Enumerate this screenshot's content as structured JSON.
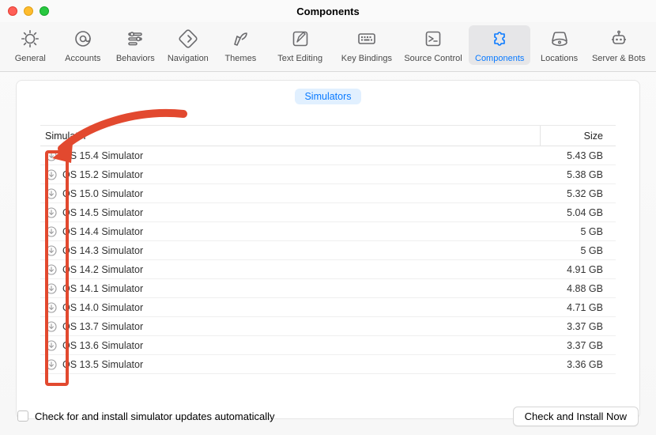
{
  "window": {
    "title": "Components"
  },
  "toolbar": {
    "items": [
      {
        "name": "general",
        "label": "General"
      },
      {
        "name": "accounts",
        "label": "Accounts"
      },
      {
        "name": "behaviors",
        "label": "Behaviors"
      },
      {
        "name": "navigation",
        "label": "Navigation"
      },
      {
        "name": "themes",
        "label": "Themes"
      },
      {
        "name": "text-editing",
        "label": "Text Editing"
      },
      {
        "name": "key-bindings",
        "label": "Key Bindings"
      },
      {
        "name": "source-control",
        "label": "Source Control"
      },
      {
        "name": "components",
        "label": "Components"
      },
      {
        "name": "locations",
        "label": "Locations"
      },
      {
        "name": "server-bots",
        "label": "Server & Bots"
      }
    ],
    "selectedIndex": 8
  },
  "segmented": {
    "simulators_label": "Simulators"
  },
  "table": {
    "header_name": "Simulator",
    "header_size": "Size",
    "rows": [
      {
        "name": "OS 15.4 Simulator",
        "size": "5.43 GB"
      },
      {
        "name": "OS 15.2 Simulator",
        "size": "5.38 GB"
      },
      {
        "name": "OS 15.0 Simulator",
        "size": "5.32 GB"
      },
      {
        "name": "OS 14.5 Simulator",
        "size": "5.04 GB"
      },
      {
        "name": "OS 14.4 Simulator",
        "size": "5 GB"
      },
      {
        "name": "OS 14.3 Simulator",
        "size": "5 GB"
      },
      {
        "name": "OS 14.2 Simulator",
        "size": "4.91 GB"
      },
      {
        "name": "OS 14.1 Simulator",
        "size": "4.88 GB"
      },
      {
        "name": "OS 14.0 Simulator",
        "size": "4.71 GB"
      },
      {
        "name": "OS 13.7 Simulator",
        "size": "3.37 GB"
      },
      {
        "name": "OS 13.6 Simulator",
        "size": "3.37 GB"
      },
      {
        "name": "OS 13.5 Simulator",
        "size": "3.36 GB"
      }
    ]
  },
  "footer": {
    "checkbox_label": "Check for and install simulator updates automatically",
    "checkbox_checked": false,
    "button_label": "Check and Install Now"
  }
}
